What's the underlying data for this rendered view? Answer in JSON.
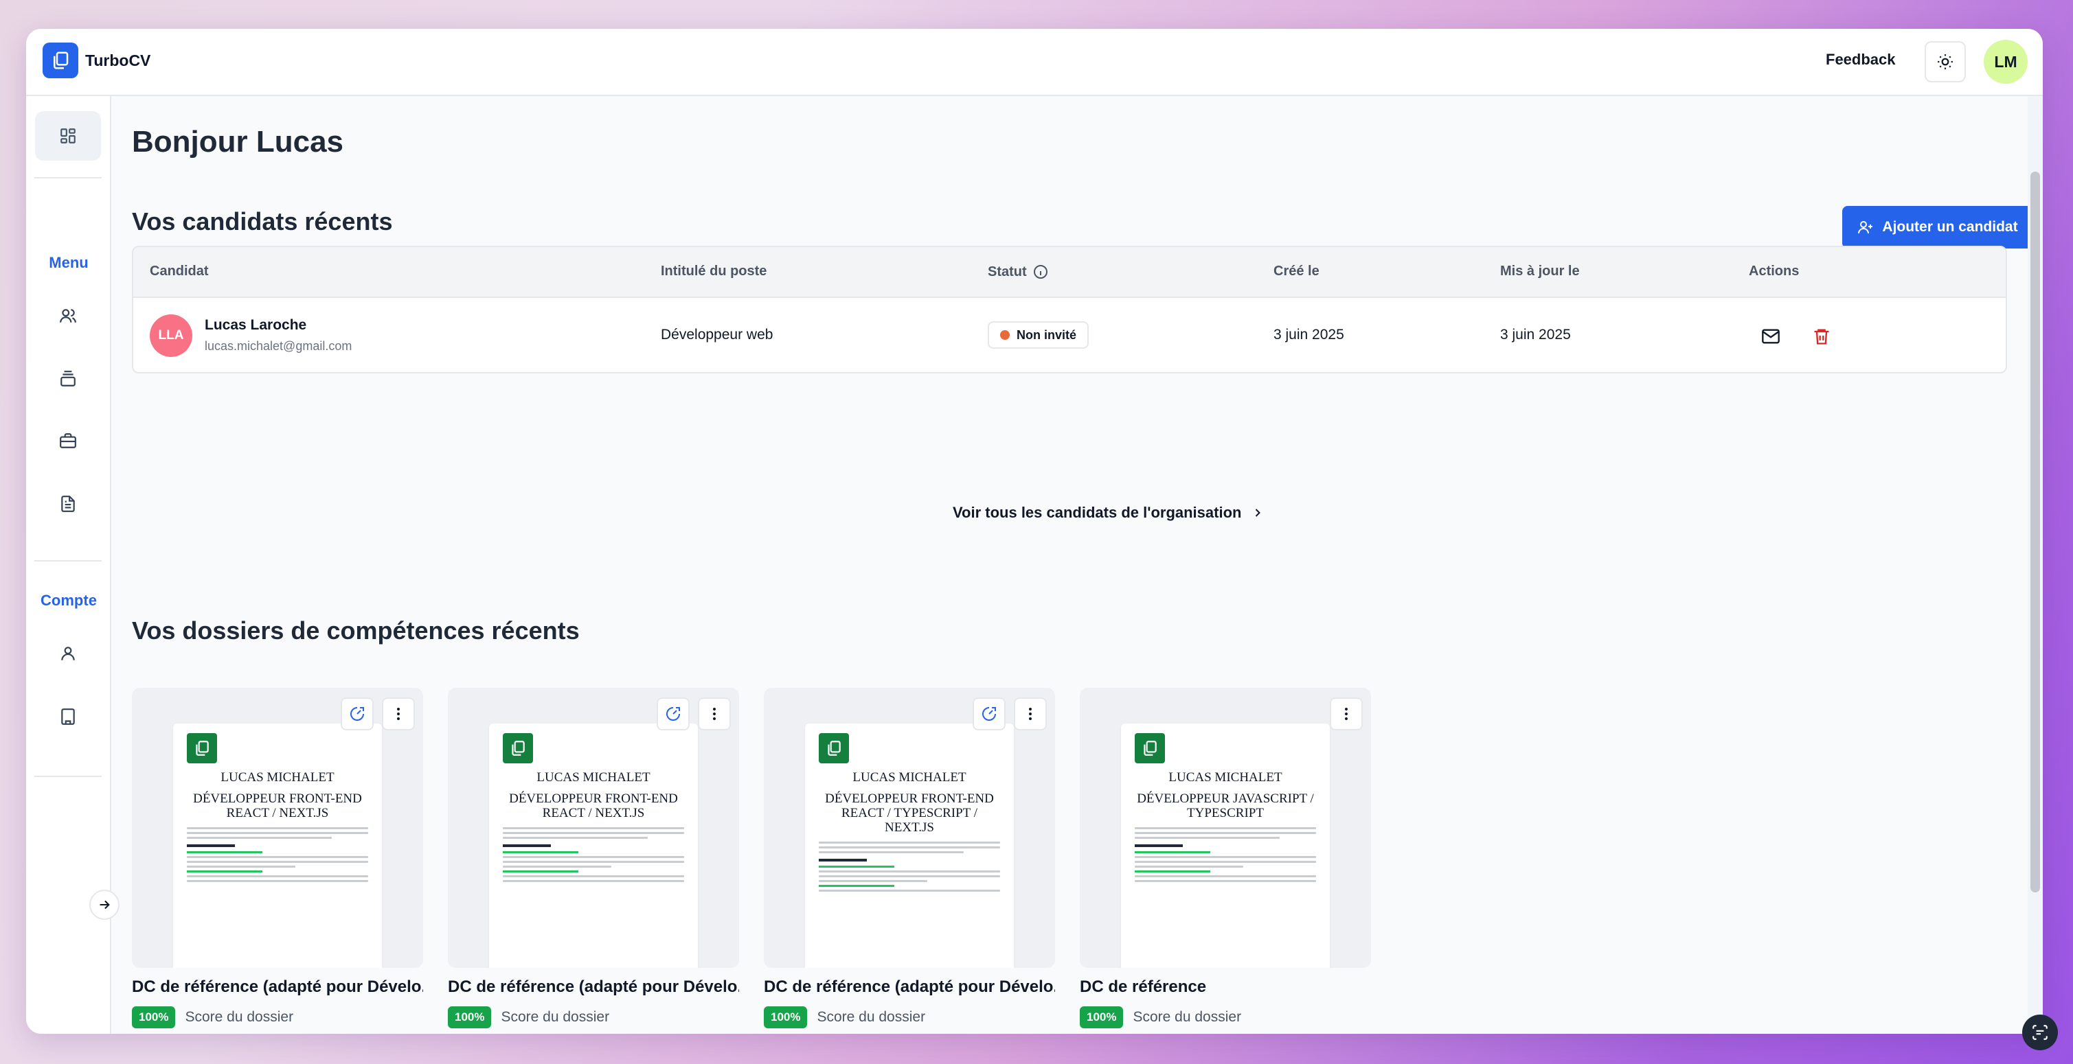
{
  "app": {
    "name": "TurboCV"
  },
  "topbar": {
    "feedback_label": "Feedback",
    "user_initials": "LM"
  },
  "sidebar": {
    "menu_label": "Menu",
    "account_label": "Compte"
  },
  "page": {
    "greeting": "Bonjour Lucas",
    "candidates_title": "Vos candidats récents",
    "add_candidate_label": "Ajouter un candidat",
    "see_all_label": "Voir tous les candidats de l'organisation",
    "dossiers_title": "Vos dossiers de compétences récents"
  },
  "table": {
    "headers": [
      "Candidat",
      "Intitulé du poste",
      "Statut",
      "Créé le",
      "Mis à jour le",
      "Actions"
    ],
    "rows": [
      {
        "initials": "LLA",
        "name": "Lucas Laroche",
        "email": "lucas.michalet@gmail.com",
        "job": "Développeur web",
        "status": "Non invité",
        "status_color": "#ea6a3a",
        "created": "3 juin 2025",
        "updated": "3 juin 2025"
      }
    ]
  },
  "cards": [
    {
      "doc_title_1": "LUCAS MICHALET",
      "doc_title_2": "DÉVELOPPEUR FRONT-END REACT / NEXT.JS",
      "title": "DC de référence (adapté pour Dévelo...",
      "score": "100%",
      "score_label": "Score du dossier",
      "state": "En cours"
    },
    {
      "doc_title_1": "LUCAS MICHALET",
      "doc_title_2": "DÉVELOPPEUR FRONT-END REACT / NEXT.JS",
      "title": "DC de référence (adapté pour Dévelo...",
      "score": "100%",
      "score_label": "Score du dossier",
      "state": "En cours"
    },
    {
      "doc_title_1": "LUCAS MICHALET",
      "doc_title_2": "DÉVELOPPEUR FRONT-END REACT / TYPESCRIPT / NEXT.JS",
      "title": "DC de référence (adapté pour Dévelo...",
      "score": "100%",
      "score_label": "Score du dossier",
      "state": "En cours"
    },
    {
      "doc_title_1": "LUCAS MICHALET",
      "doc_title_2": "DÉVELOPPEUR JAVASCRIPT / TYPESCRIPT",
      "title": "DC de référence",
      "score": "100%",
      "score_label": "Score du dossier",
      "state": "En cours"
    }
  ],
  "colors": {
    "accent": "#2563eb",
    "success": "#16a34a",
    "danger": "#dc2626",
    "pending": "#f59e0b"
  }
}
